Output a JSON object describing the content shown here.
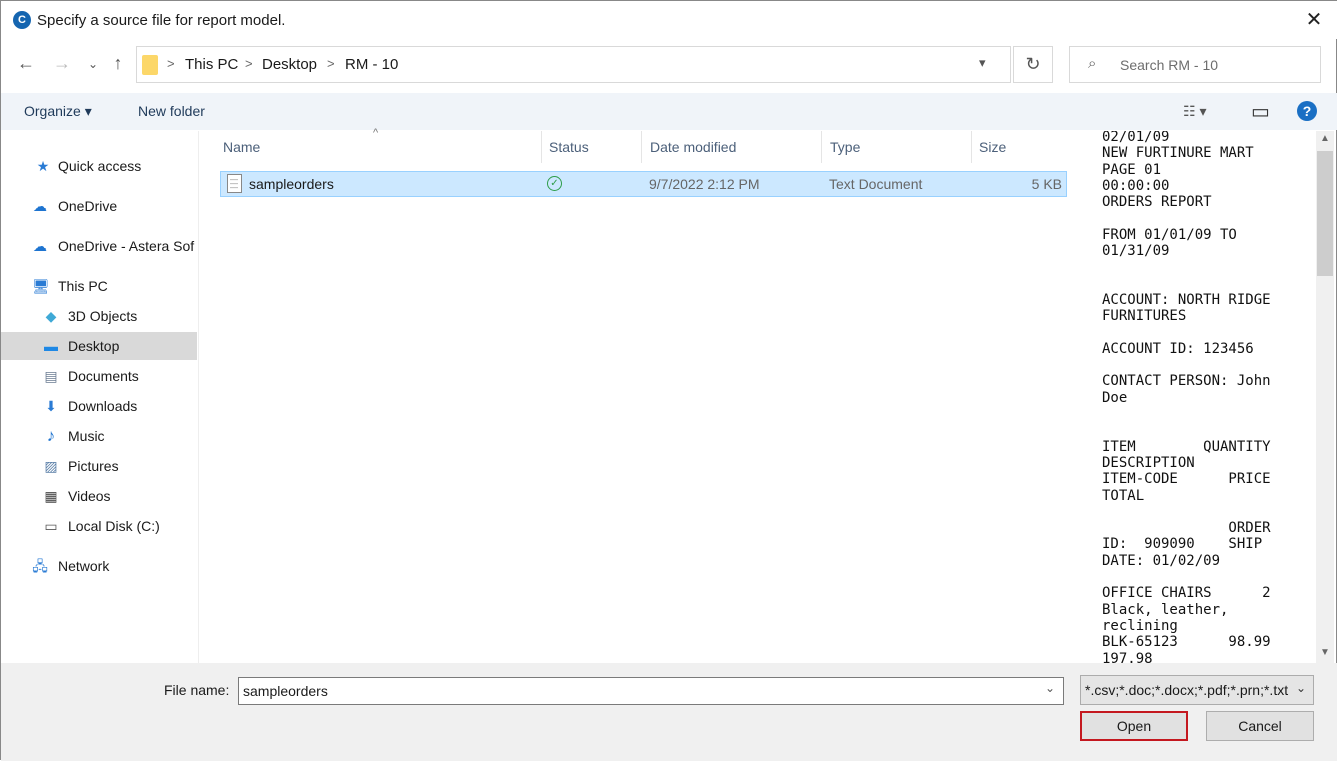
{
  "window": {
    "title": "Specify a source file for report model.",
    "icon": "app-logo-icon",
    "close": "✕"
  },
  "nav": {
    "back": "←",
    "forward": "→",
    "recent": "⌄",
    "up": "↑"
  },
  "address": {
    "crumbs": [
      "This PC",
      "Desktop",
      "RM - 10"
    ],
    "separator": ">",
    "refresh": "↻"
  },
  "search": {
    "placeholder": "Search RM - 10"
  },
  "toolbar": {
    "organize": "Organize ▾",
    "new_folder": "New folder",
    "view": "☷ ▾",
    "pane": "▭",
    "help": "?"
  },
  "sidebar": {
    "items": [
      {
        "label": "Quick access",
        "icon": "★"
      },
      {
        "label": "OneDrive",
        "icon": "☁"
      },
      {
        "label": "OneDrive - Astera Sof",
        "icon": "☁"
      },
      {
        "label": "This PC",
        "icon": "🖥"
      },
      {
        "label": "3D Objects",
        "icon": "◆"
      },
      {
        "label": "Desktop",
        "icon": "▬"
      },
      {
        "label": "Documents",
        "icon": "▤"
      },
      {
        "label": "Downloads",
        "icon": "⬇"
      },
      {
        "label": "Music",
        "icon": "♪"
      },
      {
        "label": "Pictures",
        "icon": "▨"
      },
      {
        "label": "Videos",
        "icon": "▦"
      },
      {
        "label": "Local Disk (C:)",
        "icon": "▭"
      },
      {
        "label": "Network",
        "icon": "🖧"
      }
    ]
  },
  "list": {
    "columns": [
      "Name",
      "Status",
      "Date modified",
      "Type",
      "Size"
    ],
    "rows": [
      {
        "name": "sampleorders",
        "status": "✓",
        "date": "9/7/2022 2:12 PM",
        "type": "Text Document",
        "size": "5 KB"
      }
    ]
  },
  "preview": {
    "text": "02/01/09\nNEW FURTINURE MART\nPAGE 01\n00:00:00\nORDERS REPORT\n\nFROM 01/01/09 TO\n01/31/09\n\n\nACCOUNT: NORTH RIDGE\nFURNITURES\n\nACCOUNT ID: 123456\n\nCONTACT PERSON: John\nDoe\n\n\nITEM        QUANTITY\nDESCRIPTION\nITEM-CODE      PRICE\nTOTAL\n\n               ORDER\nID:  909090    SHIP\nDATE: 01/02/09\n\nOFFICE CHAIRS      2\nBlack, leather,\nreclining\nBLK-65123      98.99\n197.98"
  },
  "footer": {
    "file_name_label": "File name:",
    "file_name": "sampleorders",
    "file_type": "*.csv;*.doc;*.docx;*.pdf;*.prn;*.txt",
    "open": "Open",
    "cancel": "Cancel"
  }
}
